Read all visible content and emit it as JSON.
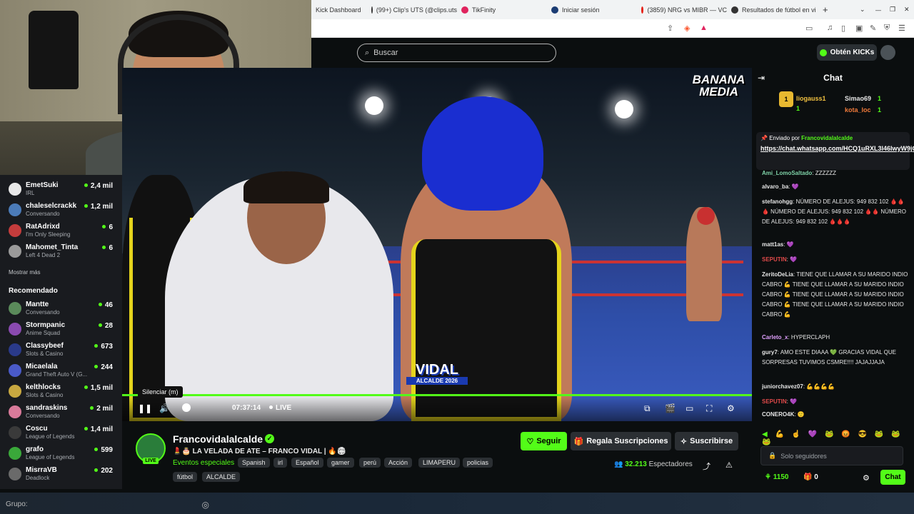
{
  "browser": {
    "tabs": [
      {
        "label": "Kick Dashboard",
        "color": "#53fc18"
      },
      {
        "label": "(99+) Clip's UTS (@clips.uts",
        "color": "#333333"
      },
      {
        "label": "TikFinity",
        "color": "#e0245e"
      },
      {
        "label": "Iniciar sesión",
        "color": "#1b3c73"
      },
      {
        "label": "(3859) NRG vs MIBR — VC",
        "color": "#e62117"
      },
      {
        "label": "Resultados de fútbol en vi",
        "color": "#333333"
      }
    ],
    "new_tab_symbol": "+",
    "window_controls": [
      "⌄",
      "—",
      "❐",
      "✕"
    ]
  },
  "kick_header": {
    "search_placeholder": "Buscar",
    "kicks_button": "Obtén KICKs"
  },
  "sidebar": {
    "following": [
      {
        "name": "EmetSuki",
        "sub": "IRL",
        "viewers": "2,4 mil",
        "color": "#e8e8e8"
      },
      {
        "name": "chaleselcrackk",
        "sub": "Conversando",
        "viewers": "1,2 mil",
        "color": "#4b7bb8"
      },
      {
        "name": "RatAdrixd",
        "sub": "I'm Only Sleeping",
        "viewers": "6",
        "color": "#c43c3c"
      },
      {
        "name": "Mahomet_Tinta",
        "sub": "Left 4 Dead 2",
        "viewers": "6",
        "color": "#9a9a9a"
      }
    ],
    "show_more": "Mostrar más",
    "recommended_title": "Recomendado",
    "recommended": [
      {
        "name": "Mantte",
        "sub": "Conversando",
        "viewers": "46",
        "color": "#5a8a5a"
      },
      {
        "name": "Stormpanic",
        "sub": "Anime Squad",
        "viewers": "28",
        "color": "#8a4ab0"
      },
      {
        "name": "Classybeef",
        "sub": "Slots & Casino",
        "viewers": "673",
        "color": "#2a3a8a"
      },
      {
        "name": "Micaelala",
        "sub": "Grand Theft Auto V (G...",
        "viewers": "244",
        "color": "#4a5ac8"
      },
      {
        "name": "kelthlocks",
        "sub": "Slots & Casino",
        "viewers": "1,5 mil",
        "color": "#c8a840"
      },
      {
        "name": "sandraskins",
        "sub": "Conversando",
        "viewers": "2 mil",
        "color": "#d87a9a"
      },
      {
        "name": "Coscu",
        "sub": "League of Legends",
        "viewers": "1,4 mil",
        "color": "#3a3a3a"
      },
      {
        "name": "grafo",
        "sub": "League of Legends",
        "viewers": "599",
        "color": "#3aa83a"
      },
      {
        "name": "MisrraVB",
        "sub": "Deadlock",
        "viewers": "202",
        "color": "#6a6a6a"
      }
    ]
  },
  "video": {
    "overlay_logo": "BANANA MEDIA",
    "overlay_banner_big": "VIDAL",
    "overlay_banner_small": "ALCALDE 2026",
    "tooltip": "Silenciar (m)",
    "time": "07:37:14",
    "live": "LIVE",
    "progress": 1.0
  },
  "stream": {
    "streamer": "Francovidalalcalde",
    "live_badge": "LIVE",
    "title": "💄🎂 LA VELADA DE ATE – FRANCO VIDAL | 🔥🏟",
    "category": "Eventos especiales",
    "tags": [
      "Spanish",
      "irl",
      "Español",
      "gamer",
      "perú",
      "Acción",
      "LIMAPERU",
      "policias",
      "fútbol",
      "ALCALDE"
    ],
    "follow": "Seguir",
    "gift": "Regala Suscripciones",
    "subscribe": "Suscribirse",
    "viewers_count": "32.213",
    "viewers_label": "Espectadores"
  },
  "chat": {
    "title": "Chat",
    "gifters": [
      {
        "name": "liogauss1",
        "count": "1"
      },
      {
        "name": "Simao69",
        "count": "1"
      },
      {
        "name": "kota_loc",
        "count": "1"
      }
    ],
    "pinned_prefix": "Enviado por",
    "pinned_by": "Francovidalalcalde",
    "pinned_link": "https://chat.whatsapp.com/HCQ1uRXL3l46IwyW9jQJMc",
    "messages": [
      {
        "user": "Ami_LomoSaltado",
        "text": "ZZZZZZ",
        "color": "#7fd3a8"
      },
      {
        "user": "alvaro_ba",
        "text": "💜",
        "color": "#ffffff"
      },
      {
        "user": "stefanohgg",
        "text": "NÚMERO DE ALEJUS: 949 832 102 🩸🩸🩸 NÚMERO DE ALEJUS: 949 832 102 🩸🩸 NÚMERO DE ALEJUS: 949 832 102 🩸🩸🩸",
        "color": "#ffffff"
      },
      {
        "user": "matt1as",
        "text": "💜",
        "color": "#ffffff"
      },
      {
        "user": "SEPUTIN",
        "text": "💜",
        "color": "#e04a4a"
      },
      {
        "user": "ZeritoDeLia",
        "text": "TIENE QUE LLAMAR A SU MARIDO INDIO CABRO 💪 TIENE QUE LLAMAR A SU MARIDO INDIO CABRO 💪 TIENE QUE LLAMAR A SU MARIDO INDIO CABRO 💪 TIENE QUE LLAMAR A SU MARIDO INDIO CABRO 💪",
        "color": "#ffffff"
      },
      {
        "user": "Carleto_x",
        "text": "HYPERCLAPH",
        "color": "#e0a0ff"
      },
      {
        "user": "gury7",
        "text": "AMO ESTE DIAAA 💚 GRACIAS VIDAL QUE SORPRESAS TUVIMOS CSMRE!!!! JAJAJJAJA",
        "color": "#ffffff"
      },
      {
        "user": "juniorchavez07",
        "text": "💪💪💪💪",
        "color": "#ffffff"
      },
      {
        "user": "SEPUTIN",
        "text": "💜",
        "color": "#e04a4a"
      },
      {
        "user": "CONERO4K",
        "text": "🙂",
        "color": "#ffffff"
      }
    ],
    "emote_row": "◀ 💪 ☝ 💜 🐸 😡 😎 🐸 🐸 🐸",
    "input_placeholder": "Solo seguidores",
    "points": "1150",
    "count": "0",
    "send": "Chat"
  },
  "bottom": {
    "group_label": "Grupo:"
  }
}
